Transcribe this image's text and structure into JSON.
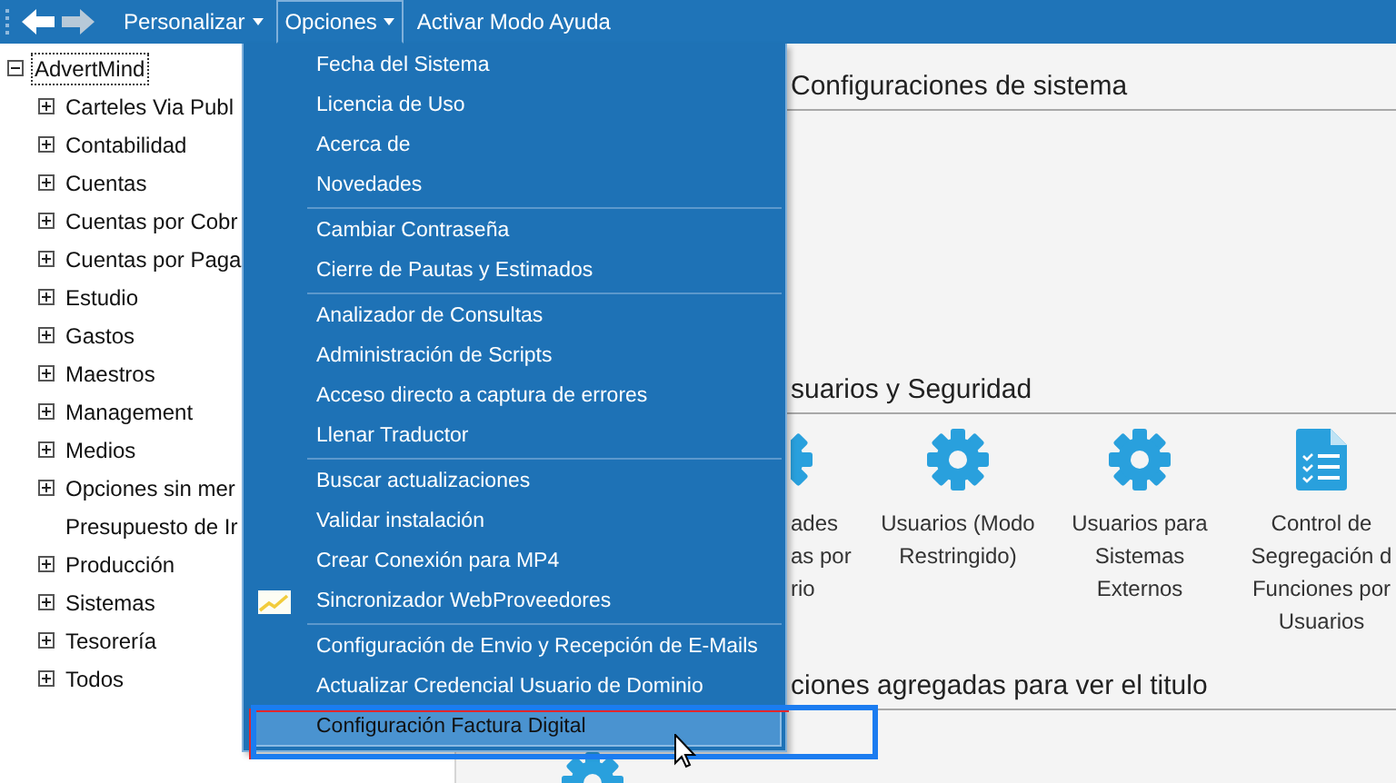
{
  "toolbar": {
    "nav": [
      {
        "kind": "back",
        "disabled": false
      },
      {
        "kind": "forward",
        "disabled": true
      }
    ],
    "menus": [
      {
        "label": "Personalizar",
        "dropdown": true,
        "open": false
      },
      {
        "label": "Opciones",
        "dropdown": true,
        "open": true
      },
      {
        "label": "Activar Modo Ayuda",
        "dropdown": false,
        "open": false
      }
    ]
  },
  "tree": {
    "label": "AdvertMind",
    "selected": true,
    "expanded": true,
    "children": [
      {
        "label": "Carteles Via Publ",
        "expandable": true,
        "expanded": false
      },
      {
        "label": "Contabilidad",
        "expandable": true,
        "expanded": false
      },
      {
        "label": "Cuentas",
        "expandable": true,
        "expanded": false
      },
      {
        "label": "Cuentas por Cobr",
        "expandable": true,
        "expanded": false
      },
      {
        "label": "Cuentas por Paga",
        "expandable": true,
        "expanded": false
      },
      {
        "label": "Estudio",
        "expandable": true,
        "expanded": false
      },
      {
        "label": "Gastos",
        "expandable": true,
        "expanded": false
      },
      {
        "label": "Maestros",
        "expandable": true,
        "expanded": false
      },
      {
        "label": "Management",
        "expandable": true,
        "expanded": false
      },
      {
        "label": "Medios",
        "expandable": true,
        "expanded": false
      },
      {
        "label": "Opciones sin mer",
        "expandable": true,
        "expanded": false
      },
      {
        "label": "Presupuesto de Ir",
        "expandable": false
      },
      {
        "label": "Producción",
        "expandable": true,
        "expanded": false
      },
      {
        "label": "Sistemas",
        "expandable": true,
        "expanded": false
      },
      {
        "label": "Tesorería",
        "expandable": true,
        "expanded": false
      },
      {
        "label": "Todos",
        "expandable": true,
        "expanded": false
      }
    ]
  },
  "content": {
    "sections": [
      {
        "title": "Configuraciones de sistema"
      },
      {
        "title": "suarios y Seguridad",
        "tiles": [
          {
            "kind": "partial",
            "lines": [
              "ades",
              "as por",
              "rio"
            ]
          },
          {
            "kind": "gear",
            "lines": [
              "Usuarios (Modo",
              "Restringido)"
            ]
          },
          {
            "kind": "gear",
            "lines": [
              "Usuarios para",
              "Sistemas",
              "Externos"
            ]
          },
          {
            "kind": "document",
            "lines": [
              "Control de",
              "Segregación d",
              "Funciones por",
              "Usuarios"
            ]
          }
        ]
      },
      {
        "title": "ciones agregadas para ver el titulo",
        "tiles": [
          {
            "kind": "gear"
          }
        ]
      }
    ]
  },
  "options_menu": {
    "groups": [
      [
        {
          "label": "Fecha del Sistema",
          "selected": false
        },
        {
          "label": "Licencia de Uso",
          "selected": false
        },
        {
          "label": "Acerca de",
          "selected": false
        },
        {
          "label": "Novedades",
          "selected": false
        }
      ],
      [
        {
          "label": "Cambiar Contraseña",
          "selected": false
        },
        {
          "label": "Cierre de Pautas y Estimados",
          "selected": false
        }
      ],
      [
        {
          "label": "Analizador de Consultas",
          "selected": false
        },
        {
          "label": "Administración de Scripts",
          "selected": false
        },
        {
          "label": "Acceso directo a captura de errores",
          "selected": false
        },
        {
          "label": "Llenar Traductor",
          "selected": false
        }
      ],
      [
        {
          "label": "Buscar actualizaciones",
          "selected": false
        },
        {
          "label": "Validar instalación",
          "selected": false
        },
        {
          "label": "Crear Conexión para MP4",
          "selected": false
        },
        {
          "label": "Sincronizador WebProveedores",
          "selected": false,
          "kind": "chart"
        }
      ],
      [
        {
          "label": "Configuración de Envio y Recepción de E-Mails",
          "selected": false
        },
        {
          "label": "Actualizar Credencial Usuario de Dominio",
          "selected": false
        },
        {
          "label": "Configuración Factura Digital",
          "selected": true
        }
      ]
    ]
  }
}
